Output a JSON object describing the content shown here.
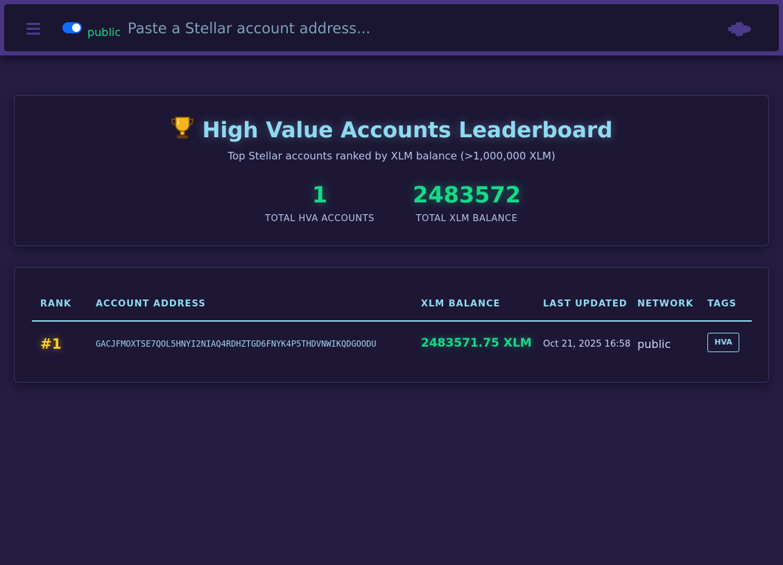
{
  "topbar": {
    "network": "public",
    "search_placeholder": "Paste a Stellar account address...",
    "toggle_on": true,
    "icons": [
      "menu-icon",
      "rocket-icon"
    ]
  },
  "hero": {
    "title": "High Value Accounts Leaderboard",
    "subtitle": "Top Stellar accounts ranked by XLM balance (>1,000,000 XLM)",
    "stats": [
      {
        "value": "1",
        "label": "TOTAL HVA ACCOUNTS"
      },
      {
        "value": "2483572",
        "label": "TOTAL XLM BALANCE"
      }
    ]
  },
  "table": {
    "headers": [
      "RANK",
      "ACCOUNT ADDRESS",
      "XLM BALANCE",
      "LAST UPDATED",
      "NETWORK",
      "TAGS"
    ],
    "rows": [
      {
        "rank": "#1",
        "address": "GACJFMOXTSE7QOL5HNYI2NIAQ4RDHZTGD6FNYK4P5THDVNWIKQDGOODU",
        "balance": "2483571.75 XLM",
        "updated": "Oct 21, 2025 16:58",
        "network": "public",
        "tag": "HVA"
      }
    ]
  },
  "colors": {
    "accent_cyan": "#8fdaf0",
    "accent_green": "#16d98a",
    "rank_gold": "#ffd21f",
    "background": "#251d41",
    "topbar_border": "#4a3585"
  }
}
